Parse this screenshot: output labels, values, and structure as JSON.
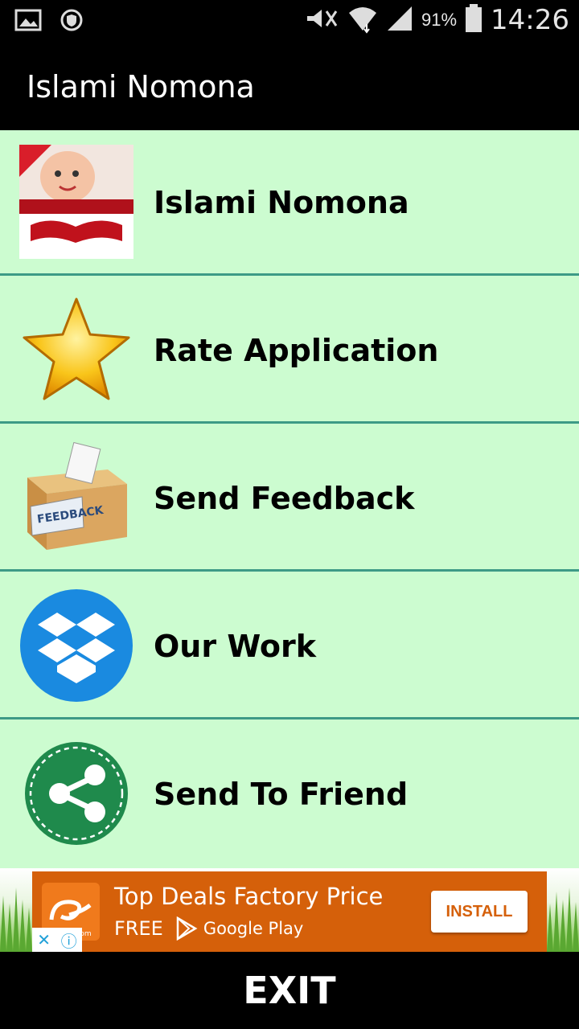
{
  "status_bar": {
    "battery_percent": "91%",
    "time": "14:26",
    "icons": [
      "gallery-icon",
      "shield-icon",
      "mute-icon",
      "wifi-icon",
      "signal-icon",
      "battery-icon"
    ]
  },
  "app_bar": {
    "title": "Islami Nomona"
  },
  "menu": {
    "items": [
      {
        "label": "Islami Nomona",
        "icon": "app-thumbnail-icon"
      },
      {
        "label": "Rate Application",
        "icon": "star-icon"
      },
      {
        "label": "Send Feedback",
        "icon": "feedback-box-icon"
      },
      {
        "label": "Our Work",
        "icon": "dropbox-icon"
      },
      {
        "label": "Send To Friend",
        "icon": "share-icon"
      }
    ]
  },
  "ad": {
    "title": "Top Deals Factory Price",
    "free_label": "FREE",
    "store_label": "Google Play",
    "install_label": "INSTALL",
    "brand": "Alibaba.com",
    "colors": {
      "card": "#d5600a",
      "install_text": "#d5600a"
    }
  },
  "footer": {
    "exit_label": "EXIT"
  },
  "colors": {
    "background": "#ccfcd0",
    "divider": "#3d9a86",
    "bars": "#000000"
  }
}
